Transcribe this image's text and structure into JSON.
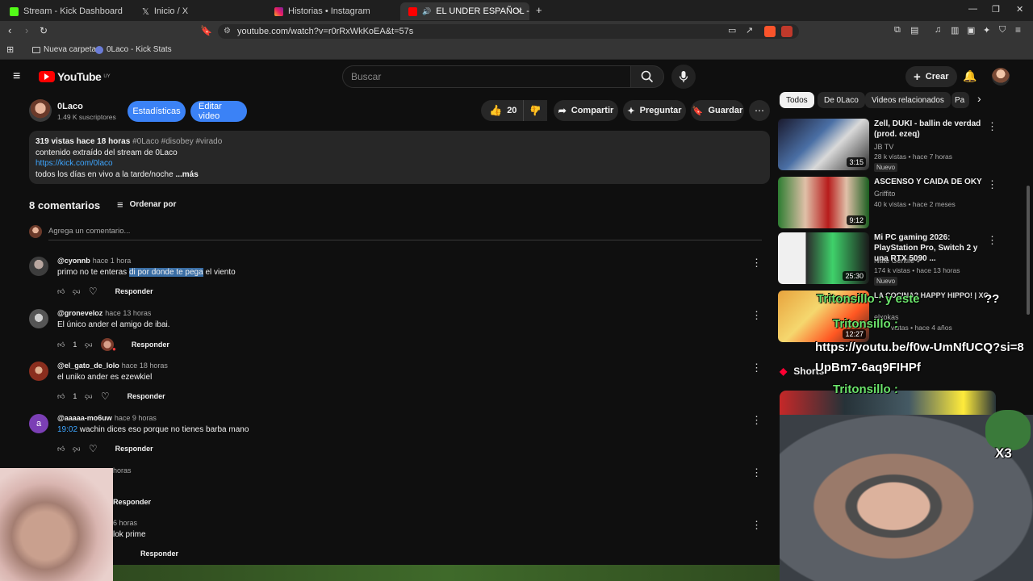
{
  "browser": {
    "tabs": [
      {
        "label": "Stream - Kick Dashboard"
      },
      {
        "label": "Inicio / X"
      },
      {
        "label": "Historias • Instagram"
      },
      {
        "label": "EL UNDER ESPAÑOL - YouTub"
      }
    ],
    "url": "youtube.com/watch?v=r0rRxWkKoEA&t=57s",
    "bookmarks": [
      "Nueva carpeta",
      "0Laco - Kick Stats"
    ]
  },
  "yt": {
    "logo": "YouTube",
    "region": "UY",
    "search_placeholder": "Buscar",
    "create_label": "Crear"
  },
  "channel": {
    "name": "0Laco",
    "subs": "1.49 K suscriptores",
    "stats_label": "Estadísticas",
    "edit_label": "Editar video"
  },
  "actions": {
    "likes": "20",
    "share": "Compartir",
    "ask": "Preguntar",
    "save": "Guardar"
  },
  "description": {
    "stats": "319 vistas  hace 18 horas",
    "tags": "#0Laco #disobey #virado",
    "line1": "contenido extraído del stream de 0Laco",
    "link": "https://kick.com/0laco",
    "line3": "todos los días en vivo a la tarde/noche",
    "more": "...más"
  },
  "comments_section": {
    "count": "8 comentarios",
    "sort": "Ordenar por",
    "add_placeholder": "Agrega un comentario..."
  },
  "comments": [
    {
      "author": "@cyonnb",
      "time": "hace 1 hora",
      "text_a": "primo no te enteras ",
      "text_sel": "di por donde te pega",
      "text_b": " el viento",
      "likes": "",
      "reply": "Responder"
    },
    {
      "author": "@groneveloz",
      "time": "hace 13 horas",
      "text": "El único ander el amigo de ibai.",
      "likes": "1",
      "reply": "Responder"
    },
    {
      "author": "@el_gato_de_lolo",
      "time": "hace 18 horas",
      "text": "el uniko ander es ezewkiel",
      "likes": "1",
      "reply": "Responder"
    },
    {
      "author": "@aaaaa-mo6uw",
      "time": "hace 9 horas",
      "timestamp": "19:02",
      "text": " wachin dices eso porque no tienes barba mano",
      "likes": "",
      "reply": "Responder"
    },
    {
      "partial_time": "horas",
      "partial_text": "",
      "reply": "Responder"
    },
    {
      "partial_time": "6 horas",
      "partial_text": "lok prime",
      "reply": "Responder"
    }
  ],
  "sidebar": {
    "chips": [
      "Todos",
      "De 0Laco",
      "Videos relacionados",
      "Pa"
    ],
    "recs": [
      {
        "title": "Zell, DUKI - ballin de verdad (prod. ezeq)",
        "channel": "JB TV",
        "meta": "28 k vistas • hace 7 horas",
        "badge": "Nuevo",
        "duration": "3:15"
      },
      {
        "title": "ASCENSO Y CAIDA DE OKY",
        "channel": "Griffito",
        "meta": "40 k vistas • hace 2 meses",
        "badge": "",
        "duration": "9:12"
      },
      {
        "title": "Mi PC gaming 2026: PlayStation Pro, Switch 2 y una RTX 5090 ...",
        "channel": "Nate Gentile",
        "meta": "174 k vistas • hace 13 horas",
        "badge": "Nuevo",
        "duration": "25:30"
      },
      {
        "title": "LA COCINA? HAPPY HIPPO! | XC",
        "channel": "elxokas",
        "meta": "vistas • hace 4 años",
        "badge": "",
        "duration": "12:27"
      }
    ],
    "shorts_label": "Shorts"
  },
  "stream_overlay": {
    "chat1": "Tritonsillo : y este",
    "chat1_tail": "??",
    "chat2": "Tritonsillo :",
    "link": "https://youtu.be/f0w-UmNfUCQ?si=8UpBm7-6aq9FIHPf",
    "chat3": "Tritonsillo :",
    "x3": "X3"
  }
}
